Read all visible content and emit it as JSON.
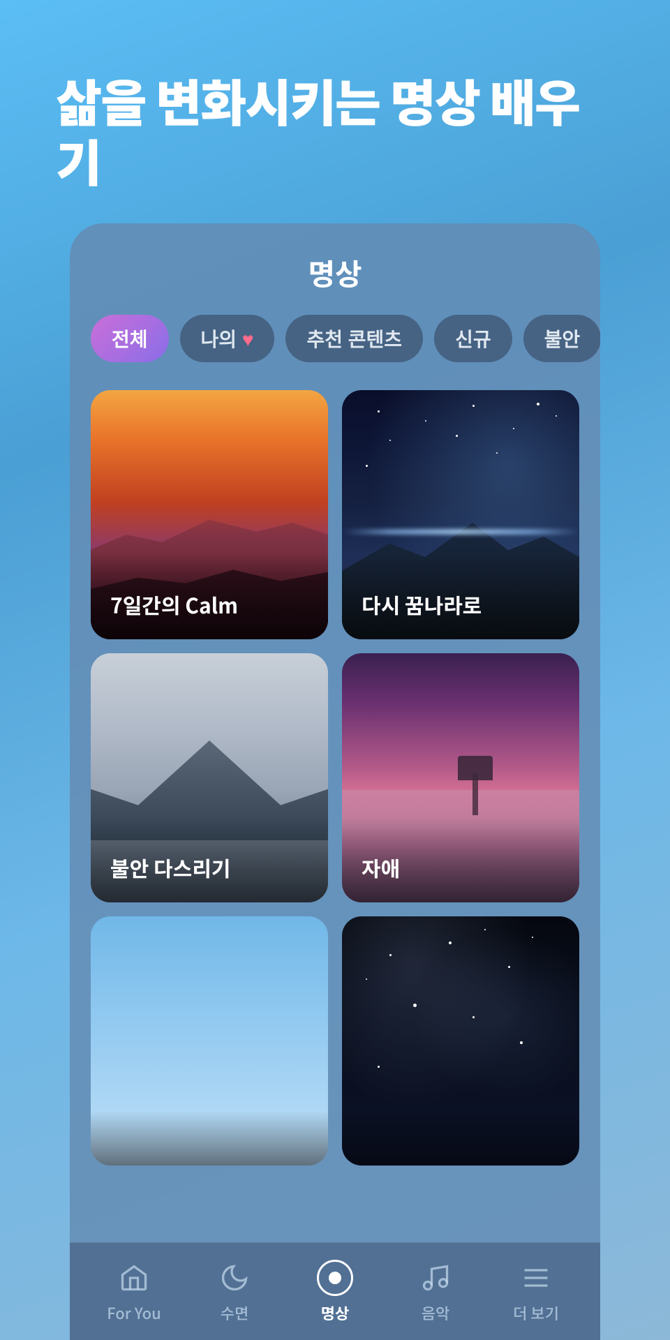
{
  "page": {
    "background_color": "#5bbef5",
    "title": "삶을 변화시키는 명상 배우기"
  },
  "header": {
    "title": "삶을 변화시키는 명상 배우기"
  },
  "card_section": {
    "title": "명상",
    "filters": [
      {
        "id": "all",
        "label": "전체",
        "active": true
      },
      {
        "id": "my",
        "label": "나의 ♥",
        "active": false
      },
      {
        "id": "recommended",
        "label": "추천 콘텐츠",
        "active": false
      },
      {
        "id": "new",
        "label": "신규",
        "active": false
      },
      {
        "id": "anxiety",
        "label": "불안",
        "active": false
      }
    ],
    "content_items": [
      {
        "id": 1,
        "title": "7일간의 Calm",
        "theme": "sunset"
      },
      {
        "id": 2,
        "title": "다시 꿈나라로",
        "theme": "night-stars"
      },
      {
        "id": 3,
        "title": "불안 다스리기",
        "theme": "mountain"
      },
      {
        "id": 4,
        "title": "자애",
        "theme": "pink-sunset"
      },
      {
        "id": 5,
        "title": "",
        "theme": "blue-sky"
      },
      {
        "id": 6,
        "title": "",
        "theme": "starry"
      }
    ]
  },
  "bottom_nav": {
    "items": [
      {
        "id": "for-you",
        "label": "For You",
        "icon": "home",
        "active": false
      },
      {
        "id": "sleep",
        "label": "수면",
        "icon": "moon",
        "active": false
      },
      {
        "id": "meditation",
        "label": "명상",
        "icon": "circle",
        "active": true
      },
      {
        "id": "music",
        "label": "음악",
        "icon": "music",
        "active": false
      },
      {
        "id": "more",
        "label": "더 보기",
        "icon": "menu",
        "active": false
      }
    ]
  }
}
